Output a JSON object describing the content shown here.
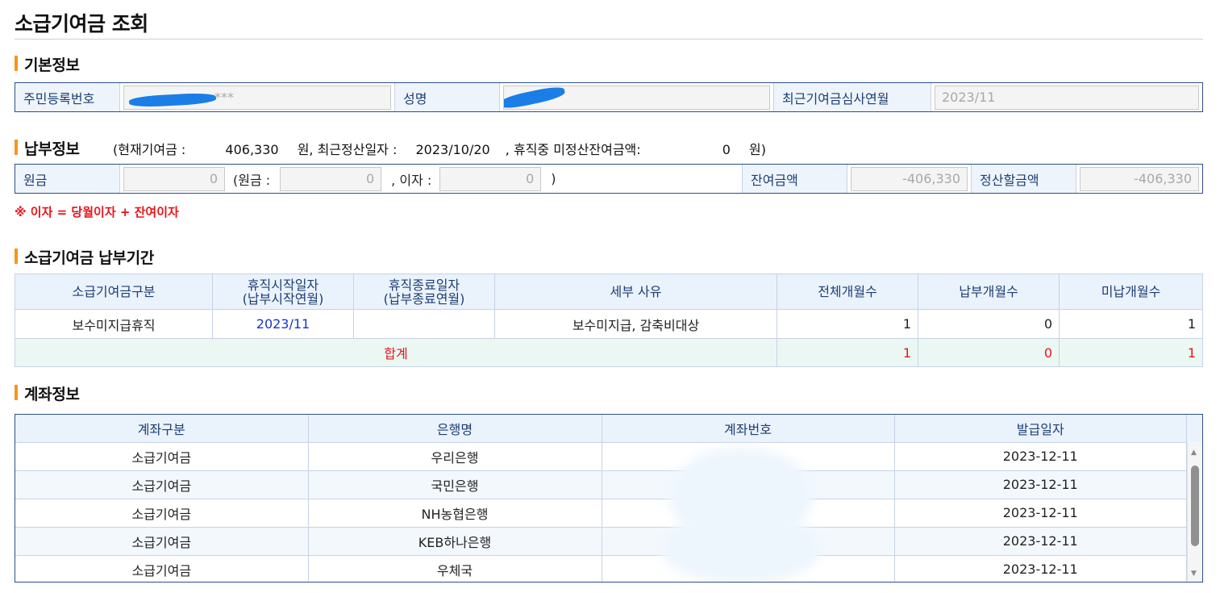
{
  "page": {
    "title": "소급기여금 조회"
  },
  "basic": {
    "section_title": "기본정보",
    "rrn_label": "주민등록번호",
    "rrn_value_suffix": "***",
    "name_label": "성명",
    "review_label": "최근기여금심사연월",
    "review_value": "2023/11"
  },
  "payment": {
    "section_title": "납부정보",
    "summary": {
      "open": "(현재기여금 :",
      "current_amount": "406,330",
      "won1": "원, 최근정산일자 :",
      "settle_date": "2023/10/20",
      "leave_label": ", 휴직중 미정산잔여금액:",
      "leave_amount": "0",
      "won2": "원)"
    },
    "principal_label": "원금",
    "principal_value": "0",
    "paren_open": "(원금 :",
    "principal_inner": "0",
    "interest_label": ", 이자 :",
    "interest_value": "0",
    "paren_close": ")",
    "balance_label": "잔여금액",
    "balance_value": "-406,330",
    "settle_label": "정산할금액",
    "settle_value": "-406,330"
  },
  "note": "※ 이자 = 당월이자 + 잔여이자",
  "period": {
    "section_title": "소급기여금 납부기간",
    "headers": [
      "소급기여금구분",
      "휴직시작일자\n(납부시작연월)",
      "휴직종료일자\n(납부종료연월)",
      "세부 사유",
      "전체개월수",
      "납부개월수",
      "미납개월수"
    ],
    "row": {
      "type": "보수미지급휴직",
      "start": "2023/11",
      "end": "",
      "reason": "보수미지급, 감축비대상",
      "total": "1",
      "paid": "0",
      "unpaid": "1"
    },
    "sum": {
      "label": "합계",
      "total": "1",
      "paid": "0",
      "unpaid": "1"
    }
  },
  "account": {
    "section_title": "계좌정보",
    "headers": [
      "계좌구분",
      "은행명",
      "계좌번호",
      "발급일자"
    ],
    "rows": [
      {
        "type": "소급기여금",
        "bank": "우리은행",
        "number": "",
        "date": "2023-12-11"
      },
      {
        "type": "소급기여금",
        "bank": "국민은행",
        "number": "",
        "date": "2023-12-11"
      },
      {
        "type": "소급기여금",
        "bank": "NH농협은행",
        "number": "",
        "date": "2023-12-11"
      },
      {
        "type": "소급기여금",
        "bank": "KEB하나은행",
        "number": "",
        "date": "2023-12-11"
      },
      {
        "type": "소급기여금",
        "bank": "우체국",
        "number": "",
        "date": "2023-12-11"
      }
    ]
  },
  "colors": {
    "accent": "#f7941d",
    "border": "#2b4f8c",
    "header_bg": "#eaf2fb",
    "red": "#e8141a",
    "blue": "#1a33c8"
  }
}
